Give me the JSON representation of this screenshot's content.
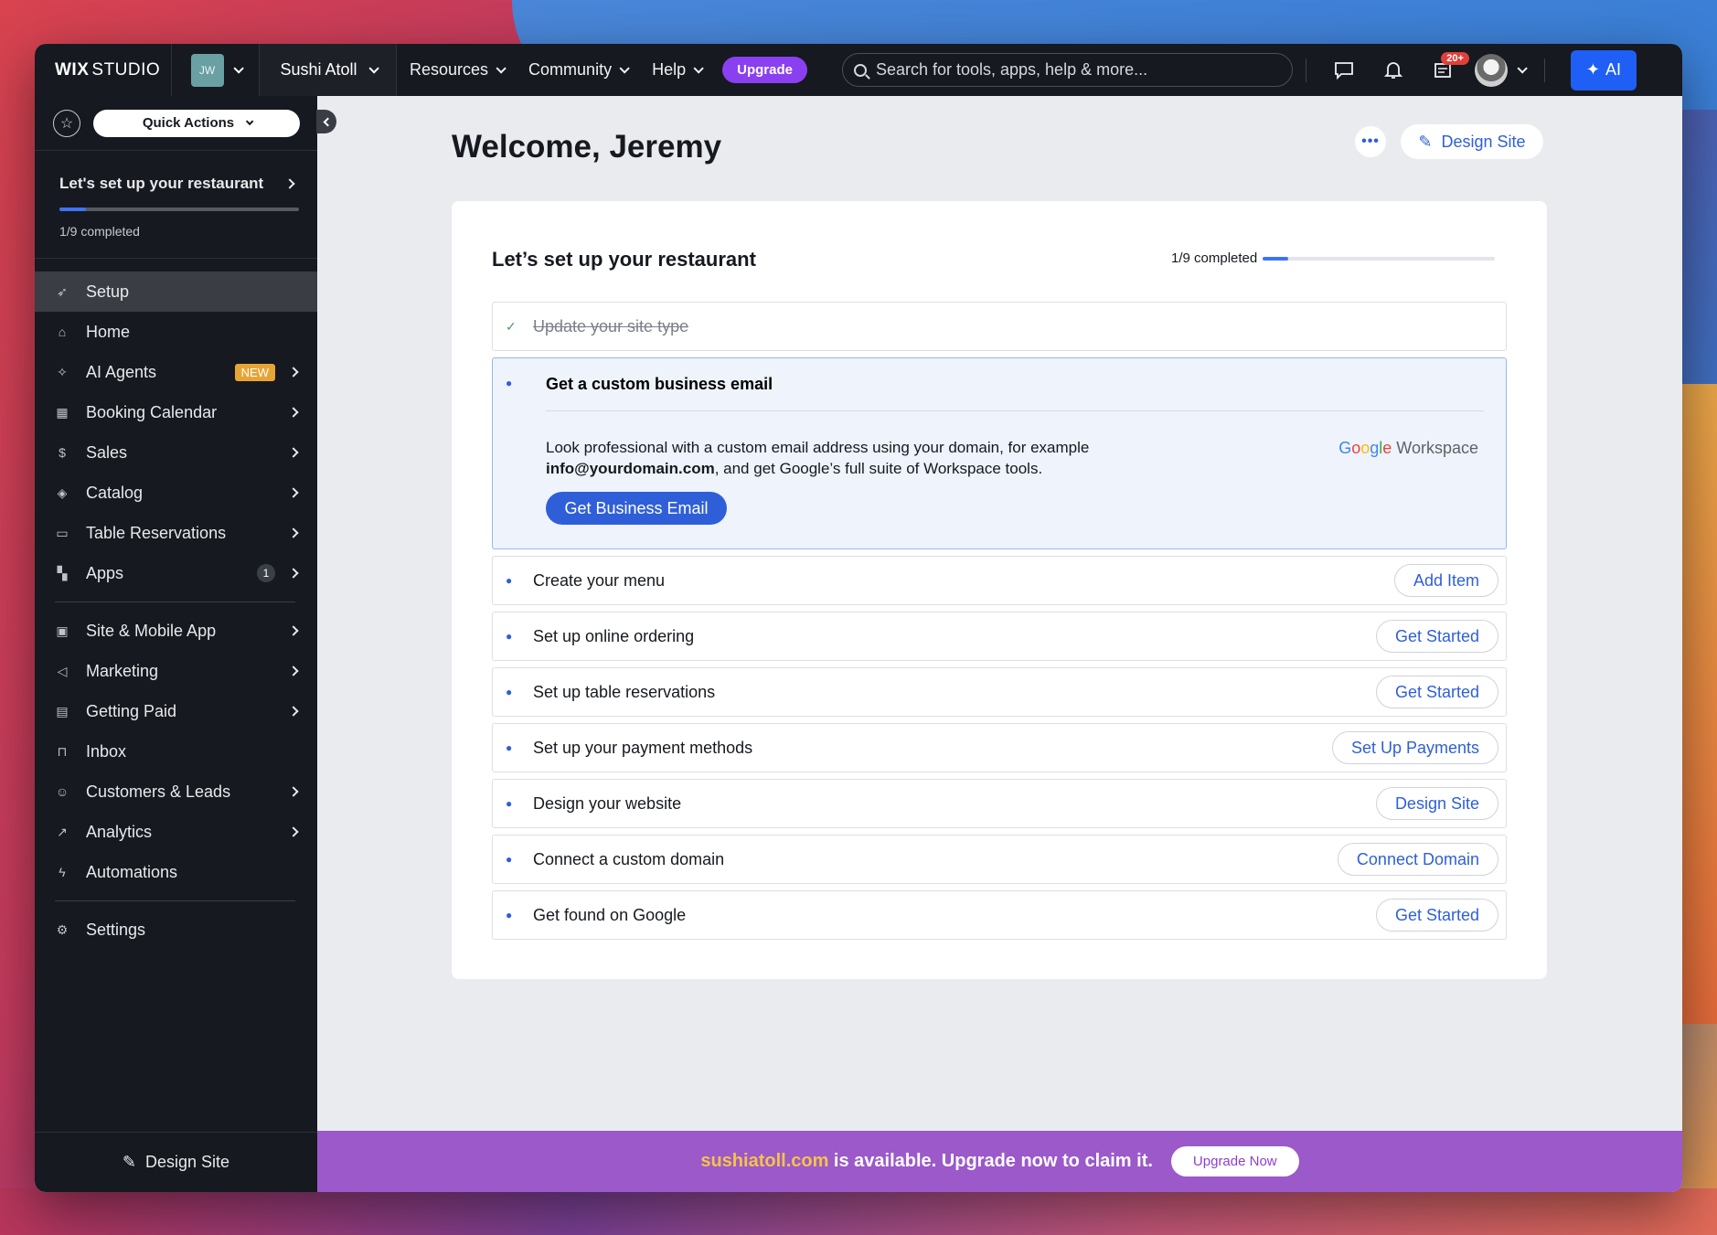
{
  "topbar": {
    "logo_bold": "WIX",
    "logo_light": "STUDIO",
    "workspace_initials": "JW",
    "site_name": "Sushi Atoll",
    "nav": [
      "Resources",
      "Community",
      "Help"
    ],
    "upgrade_label": "Upgrade",
    "search_placeholder": "Search for tools, apps, help & more...",
    "notif_count": "20+",
    "ai_label": "AI"
  },
  "sidebar": {
    "quick_actions_label": "Quick Actions",
    "setup_card": {
      "title": "Let's set up your restaurant",
      "progress": 0.11,
      "completed_text": "1/9 completed"
    },
    "items_top": [
      {
        "label": "Setup",
        "icon": "rocket-icon",
        "active": true,
        "arrow": false
      },
      {
        "label": "Home",
        "icon": "home-icon",
        "arrow": false
      },
      {
        "label": "AI Agents",
        "icon": "sparkle-icon",
        "tag": "NEW",
        "arrow": true
      },
      {
        "label": "Booking Calendar",
        "icon": "calendar-icon",
        "arrow": true
      },
      {
        "label": "Sales",
        "icon": "dollar-icon",
        "arrow": true
      },
      {
        "label": "Catalog",
        "icon": "box-icon",
        "arrow": true
      },
      {
        "label": "Table Reservations",
        "icon": "table-icon",
        "arrow": true
      },
      {
        "label": "Apps",
        "icon": "apps-icon",
        "count": "1",
        "arrow": true
      }
    ],
    "items_mid": [
      {
        "label": "Site & Mobile App",
        "icon": "devices-icon",
        "arrow": true
      },
      {
        "label": "Marketing",
        "icon": "megaphone-icon",
        "arrow": true
      },
      {
        "label": "Getting Paid",
        "icon": "receipt-icon",
        "arrow": true
      },
      {
        "label": "Inbox",
        "icon": "inbox-icon",
        "arrow": false
      },
      {
        "label": "Customers & Leads",
        "icon": "people-icon",
        "arrow": true
      },
      {
        "label": "Analytics",
        "icon": "chart-icon",
        "arrow": true
      },
      {
        "label": "Automations",
        "icon": "bolt-icon",
        "arrow": false
      }
    ],
    "items_bottom": [
      {
        "label": "Settings",
        "icon": "gear-icon",
        "arrow": false
      }
    ],
    "footer_label": "Design Site"
  },
  "main": {
    "welcome": "Welcome, Jeremy",
    "more_label": "•••",
    "design_site_label": "Design Site",
    "card": {
      "title": "Let’s set up your restaurant",
      "completed_text": "1/9 completed",
      "progress": 0.11,
      "done_task": "Update your site type",
      "expanded": {
        "title": "Get a custom business email",
        "text_before": "Look professional with a custom email address using your domain, for example",
        "text_bold": "info@yourdomain.com",
        "text_after": ", and get Google’s full suite of Workspace tools.",
        "button": "Get Business Email",
        "logo_word": "Workspace"
      },
      "tasks": [
        {
          "label": "Create your menu",
          "button": "Add Item"
        },
        {
          "label": "Set up online ordering",
          "button": "Get Started"
        },
        {
          "label": "Set up table reservations",
          "button": "Get Started"
        },
        {
          "label": "Set up your payment methods",
          "button": "Set Up Payments"
        },
        {
          "label": "Design your website",
          "button": "Design Site"
        },
        {
          "label": "Connect a custom domain",
          "button": "Connect Domain"
        },
        {
          "label": "Get found on Google",
          "button": "Get Started"
        }
      ]
    }
  },
  "banner": {
    "domain": "sushiatoll.com",
    "text": " is available. Upgrade now to claim it.",
    "button": "Upgrade Now"
  },
  "colors": {
    "accent": "#2f5fd8",
    "upgrade_purple": "#8a3ff0",
    "banner_purple": "#9b59c9",
    "new_tag": "#e7a436"
  }
}
